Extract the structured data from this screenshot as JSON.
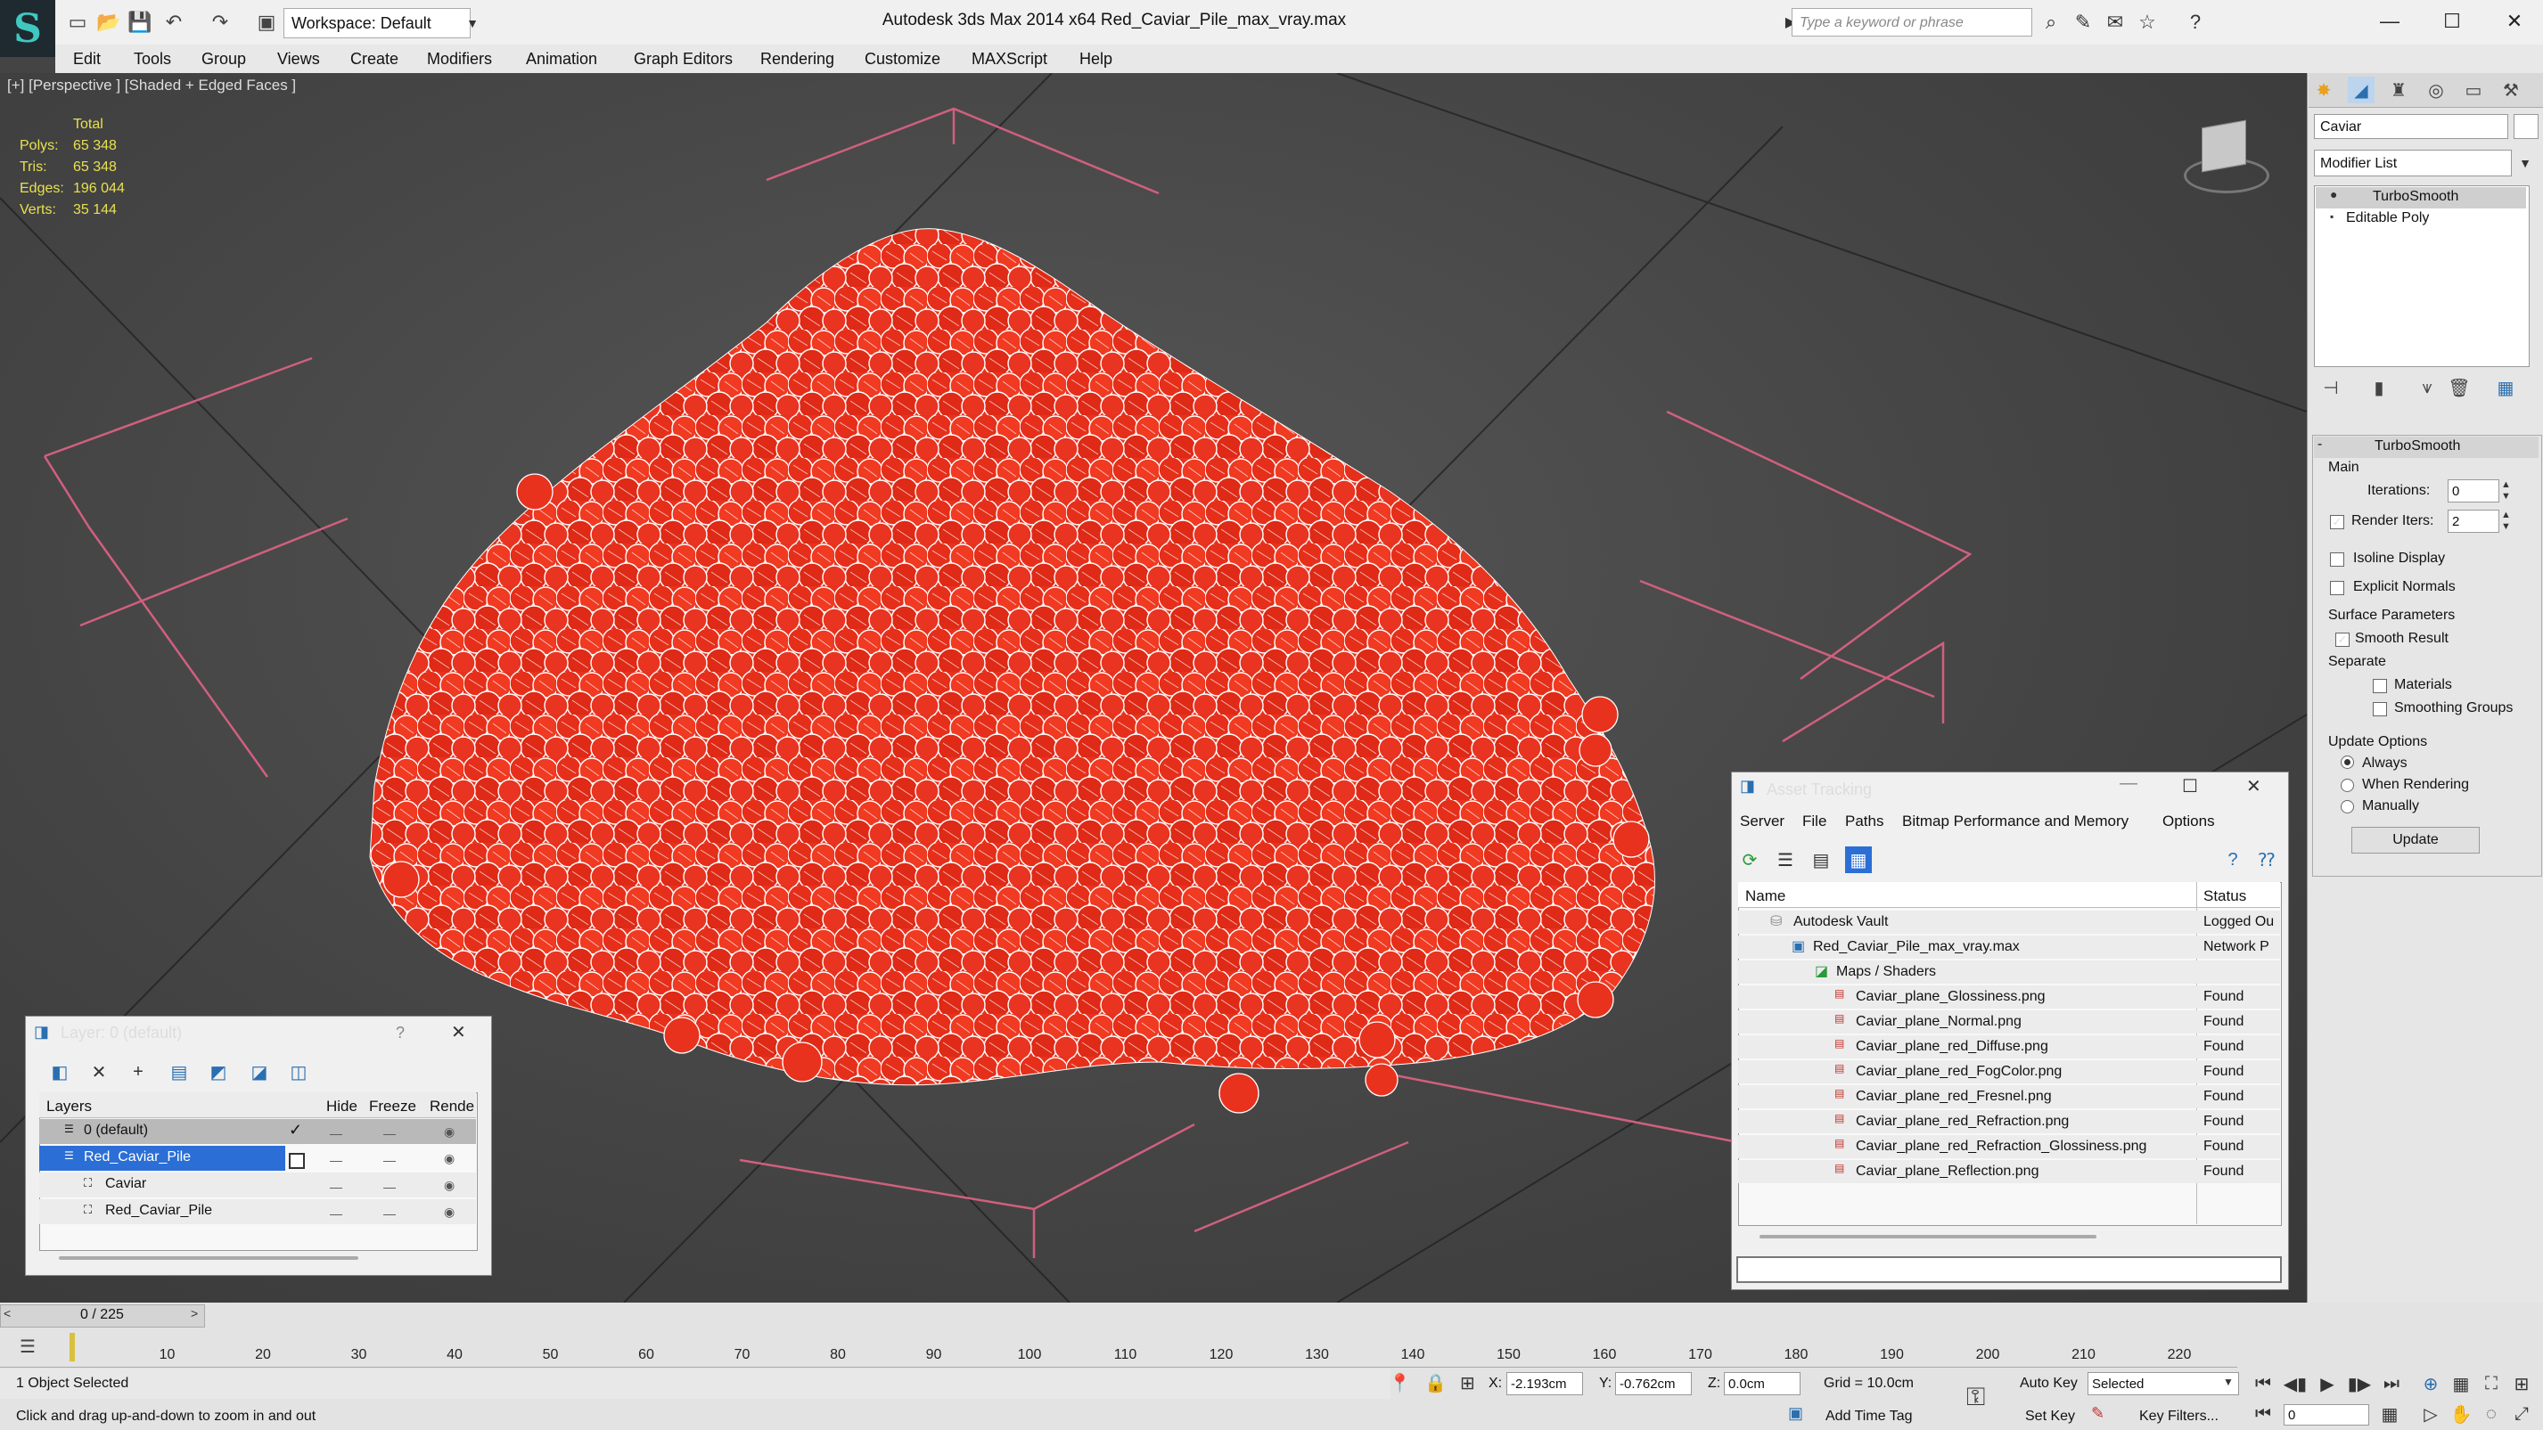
{
  "app": {
    "title": "Autodesk 3ds Max  2014 x64     Red_Caviar_Pile_max_vray.max",
    "workspace": "Workspace: Default",
    "search_placeholder": "Type a keyword or phrase"
  },
  "menu": [
    "Edit",
    "Tools",
    "Group",
    "Views",
    "Create",
    "Modifiers",
    "Animation",
    "Graph Editors",
    "Rendering",
    "Customize",
    "MAXScript",
    "Help"
  ],
  "viewport": {
    "label": "[+] [Perspective ] [Shaded + Edged Faces ]",
    "stats": {
      "total_label": "Total",
      "rows": [
        {
          "label": "Polys:",
          "value": "65 348"
        },
        {
          "label": "Tris:",
          "value": "65 348"
        },
        {
          "label": "Edges:",
          "value": "196 044"
        },
        {
          "label": "Verts:",
          "value": "35 144"
        }
      ]
    }
  },
  "command_panel": {
    "object_name": "Caviar",
    "modifier_list": "Modifier List",
    "stack": [
      "TurboSmooth",
      "Editable Poly"
    ],
    "rollout_title": "TurboSmooth",
    "main_label": "Main",
    "iterations_label": "Iterations:",
    "iterations_value": "0",
    "render_iters_label": "Render Iters:",
    "render_iters_value": "2",
    "isoline_label": "Isoline Display",
    "explicit_normals_label": "Explicit Normals",
    "surface_params_label": "Surface Parameters",
    "smooth_result_label": "Smooth Result",
    "separate_label": "Separate",
    "materials_label": "Materials",
    "smoothing_groups_label": "Smoothing Groups",
    "update_options_label": "Update Options",
    "always_label": "Always",
    "when_rendering_label": "When Rendering",
    "manually_label": "Manually",
    "update_button": "Update"
  },
  "layer_panel": {
    "title": "Layer: 0 (default)",
    "help": "?",
    "columns": {
      "layers": "Layers",
      "hide": "Hide",
      "freeze": "Freeze",
      "render": "Render"
    },
    "rows": [
      {
        "name": "0 (default)"
      },
      {
        "name": "Red_Caviar_Pile"
      },
      {
        "name": "Caviar"
      },
      {
        "name": "Red_Caviar_Pile"
      }
    ]
  },
  "asset_tracking": {
    "title": "Asset Tracking",
    "menu": [
      "Server",
      "File",
      "Paths",
      "Bitmap Performance and Memory",
      "Options"
    ],
    "columns": {
      "name": "Name",
      "status": "Status"
    },
    "rows": [
      {
        "name": "Autodesk Vault",
        "status": "Logged Ou"
      },
      {
        "name": "Red_Caviar_Pile_max_vray.max",
        "status": "Network P"
      },
      {
        "name": "Maps / Shaders",
        "status": ""
      },
      {
        "name": "Caviar_plane_Glossiness.png",
        "status": "Found"
      },
      {
        "name": "Caviar_plane_Normal.png",
        "status": "Found"
      },
      {
        "name": "Caviar_plane_red_Diffuse.png",
        "status": "Found"
      },
      {
        "name": "Caviar_plane_red_FogColor.png",
        "status": "Found"
      },
      {
        "name": "Caviar_plane_red_Fresnel.png",
        "status": "Found"
      },
      {
        "name": "Caviar_plane_red_Refraction.png",
        "status": "Found"
      },
      {
        "name": "Caviar_plane_red_Refraction_Glossiness.png",
        "status": "Found"
      },
      {
        "name": "Caviar_plane_Reflection.png",
        "status": "Found"
      }
    ]
  },
  "timeline": {
    "frame": "0 / 225",
    "ticks": [
      "10",
      "20",
      "30",
      "40",
      "50",
      "60",
      "70",
      "80",
      "90",
      "100",
      "110",
      "120",
      "130",
      "140",
      "150",
      "160",
      "170",
      "180",
      "190",
      "200",
      "210",
      "220"
    ]
  },
  "status": {
    "selection": "1 Object Selected",
    "hint": "Click and drag up-and-down to zoom in and out",
    "x_label": "X:",
    "x_value": "-2.193cm",
    "y_label": "Y:",
    "y_value": "-0.762cm",
    "z_label": "Z:",
    "z_value": "0.0cm",
    "grid": "Grid = 10.0cm",
    "add_time_tag": "Add Time Tag",
    "auto_key": "Auto Key",
    "selected": "Selected",
    "set_key": "Set Key",
    "key_filters": "Key Filters...",
    "frame_value": "0"
  },
  "colors": {
    "caviar": "#e8321e",
    "highlight": "#2b6fd6",
    "grid_pink": "#d0607e"
  }
}
